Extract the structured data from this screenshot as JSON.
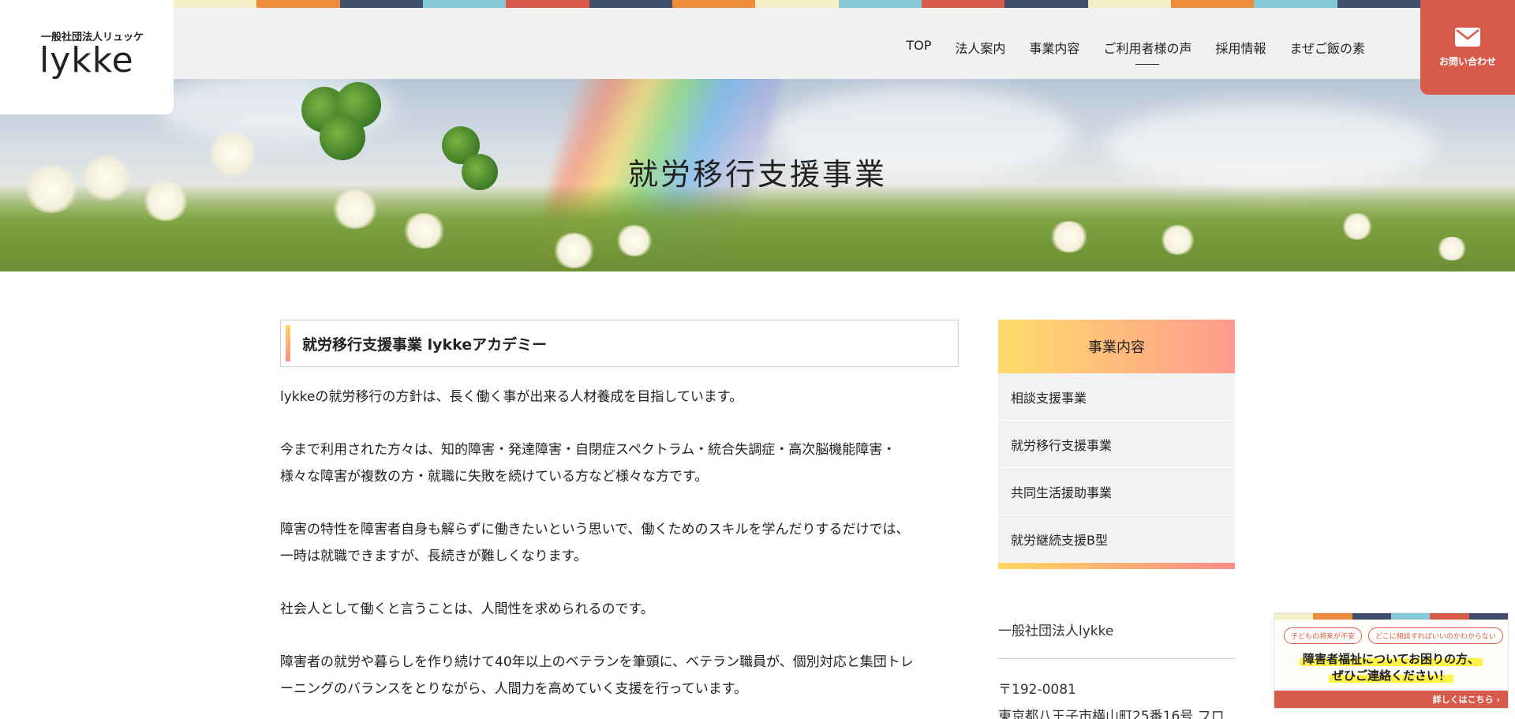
{
  "stripe_colors": [
    "#f4efc4",
    "#ee8c3c",
    "#3f4f6b",
    "#86c9d6",
    "#d85a4b",
    "#3f4f6b",
    "#ee8c3c",
    "#f4efc4",
    "#86c9d6",
    "#d85a4b",
    "#3f4f6b",
    "#f4efc4",
    "#ee8c3c",
    "#86c9d6",
    "#3f4f6b"
  ],
  "logo": {
    "sub": "一般社団法人リュッケ",
    "main": "lykke"
  },
  "nav": [
    {
      "label": "TOP",
      "active": false
    },
    {
      "label": "法人案内",
      "active": false
    },
    {
      "label": "事業内容",
      "active": false
    },
    {
      "label": "ご利用者様の声",
      "active": true
    },
    {
      "label": "採用情報",
      "active": false
    },
    {
      "label": "まぜご飯の素",
      "active": false
    }
  ],
  "contact": {
    "icon": "mail-icon",
    "label": "お問い合わせ"
  },
  "hero": {
    "title": "就労移行支援事業"
  },
  "main": {
    "heading": "就労移行支援事業 lykkeアカデミー",
    "paragraphs": [
      [
        "lykkeの就労移行の方針は、長く働く事が出来る人材養成を目指しています。"
      ],
      [
        "今まで利用された方々は、知的障害・発達障害・自閉症スペクトラム・統合失調症・高次脳機能障害・",
        "様々な障害が複数の方・就職に失敗を続けている方など様々な方です。"
      ],
      [
        "障害の特性を障害者自身も解らずに働きたいという思いで、働くためのスキルを学んだりするだけでは、",
        "一時は就職できますが、長続きが難しくなります。"
      ],
      [
        "社会人として働くと言うことは、人間性を求められるのです。"
      ],
      [
        "障害者の就労や暮らしを作り続けて40年以上のベテランを筆頭に、ベテラン職員が、個別対応と集団トレ",
        "ーニングのバランスをとりながら、人間力を高めていく支援を行っています。"
      ]
    ]
  },
  "sidebar": {
    "heading": "事業内容",
    "items": [
      "相談支援事業",
      "就労移行支援事業",
      "共同生活援助事業",
      "就労継続支援B型"
    ],
    "org_name": "一般社団法人lykke",
    "postal": "〒192-0081",
    "address": "東京都八王子市横山町25番16号 フロ"
  },
  "banner": {
    "pills": [
      "子どもの将来が不安",
      "どこに相談すればいいのかわからない"
    ],
    "line1": "障害者福祉についてお困りの方、",
    "line2": "ぜひご連絡ください！",
    "cta": "詳しくはこちら ›"
  },
  "colors": {
    "accent_red": "#d85a4b",
    "gradient_start": "#ffdc6a",
    "gradient_end": "#ff9a8e"
  }
}
